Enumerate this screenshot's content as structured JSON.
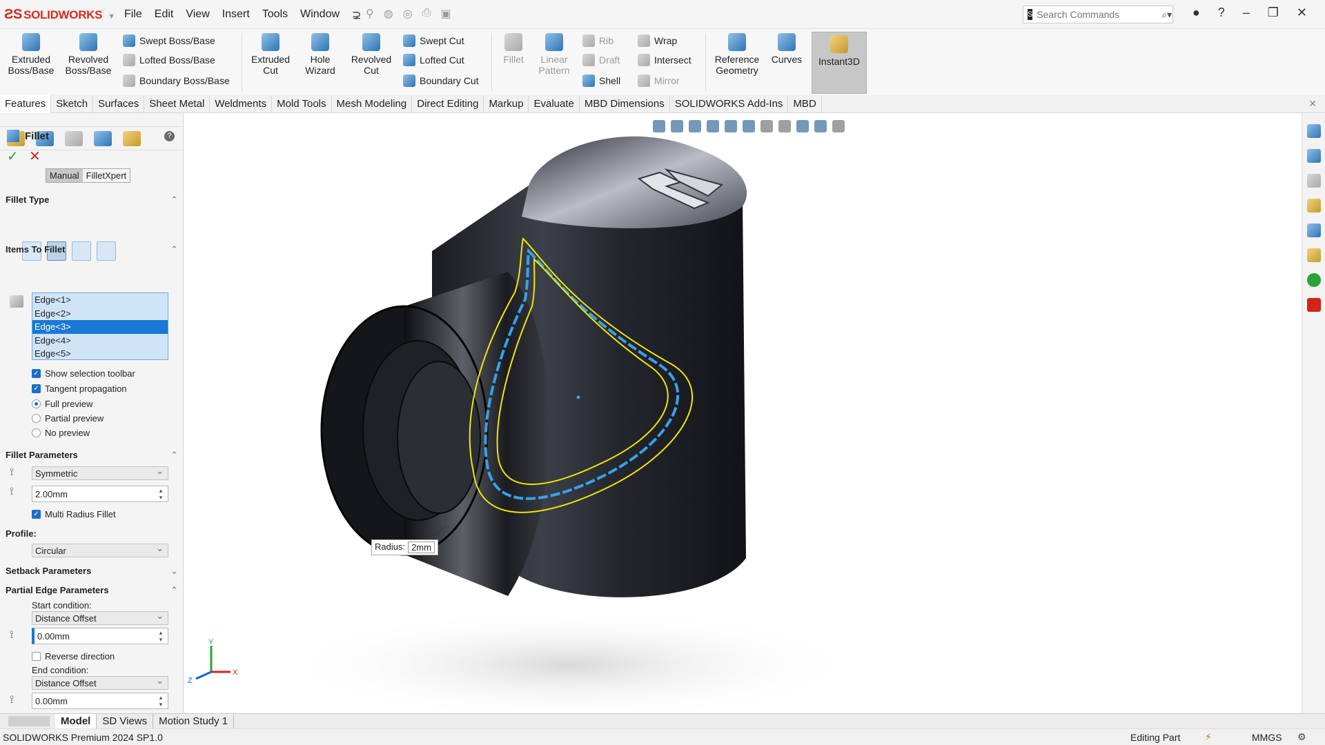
{
  "app": {
    "logo_text": "SOLIDWORKS",
    "menus": [
      "File",
      "Edit",
      "View",
      "Insert",
      "Tools",
      "Window"
    ],
    "search_placeholder": "Search Commands"
  },
  "ribbon": {
    "extruded_boss": "Extruded Boss/Base",
    "revolved_boss": "Revolved Boss/Base",
    "swept_boss": "Swept Boss/Base",
    "lofted_boss": "Lofted Boss/Base",
    "boundary_boss": "Boundary Boss/Base",
    "extruded_cut": "Extruded Cut",
    "hole_wizard": "Hole Wizard",
    "revolved_cut": "Revolved Cut",
    "swept_cut": "Swept Cut",
    "lofted_cut": "Lofted Cut",
    "boundary_cut": "Boundary Cut",
    "fillet": "Fillet",
    "linear_pattern": "Linear Pattern",
    "rib": "Rib",
    "draft": "Draft",
    "shell": "Shell",
    "wrap": "Wrap",
    "intersect": "Intersect",
    "mirror": "Mirror",
    "reference_geometry": "Reference Geometry",
    "curves": "Curves",
    "instant3d": "Instant3D"
  },
  "tabs": [
    "Features",
    "Sketch",
    "Surfaces",
    "Sheet Metal",
    "Weldments",
    "Mold Tools",
    "Mesh Modeling",
    "Direct Editing",
    "Markup",
    "Evaluate",
    "MBD Dimensions",
    "SOLIDWORKS Add-Ins",
    "MBD"
  ],
  "property_manager": {
    "title": "Fillet",
    "help": "?",
    "mode_manual": "Manual",
    "mode_xpert": "FilletXpert",
    "fillet_type_header": "Fillet Type",
    "items_header": "Items To Fillet",
    "edges": [
      "Edge<1>",
      "Edge<2>",
      "Edge<3>",
      "Edge<4>",
      "Edge<5>"
    ],
    "selected_edge_index": 2,
    "show_selection_toolbar": "Show selection toolbar",
    "tangent_propagation": "Tangent propagation",
    "full_preview": "Full preview",
    "partial_preview": "Partial preview",
    "no_preview": "No preview",
    "fillet_params_header": "Fillet Parameters",
    "symmetric": "Symmetric",
    "radius_value": "2.00mm",
    "multi_radius": "Multi Radius Fillet",
    "profile_label": "Profile:",
    "profile_value": "Circular",
    "setback_header": "Setback Parameters",
    "partial_edge_header": "Partial Edge Parameters",
    "start_condition_label": "Start condition:",
    "start_condition_value": "Distance Offset",
    "start_offset": "0.00mm",
    "reverse_direction": "Reverse direction",
    "end_condition_label": "End condition:",
    "end_condition_value": "Distance Offset",
    "end_offset": "0.00mm"
  },
  "viewport": {
    "radius_label": "Radius:",
    "radius_value": "2mm",
    "axis_x": "X",
    "axis_y": "Y",
    "axis_z": "Z"
  },
  "bottom_tabs": [
    "Model",
    "SD Views",
    "Motion Study 1"
  ],
  "status": {
    "version": "SOLIDWORKS Premium 2024 SP1.0",
    "mode": "Editing Part",
    "units": "MMGS"
  },
  "colors": {
    "brand_red": "#d52b1e",
    "selection_blue": "#1a78d6",
    "preview_yellow": "#f4e600",
    "edge_blue": "#3aa0ea"
  }
}
